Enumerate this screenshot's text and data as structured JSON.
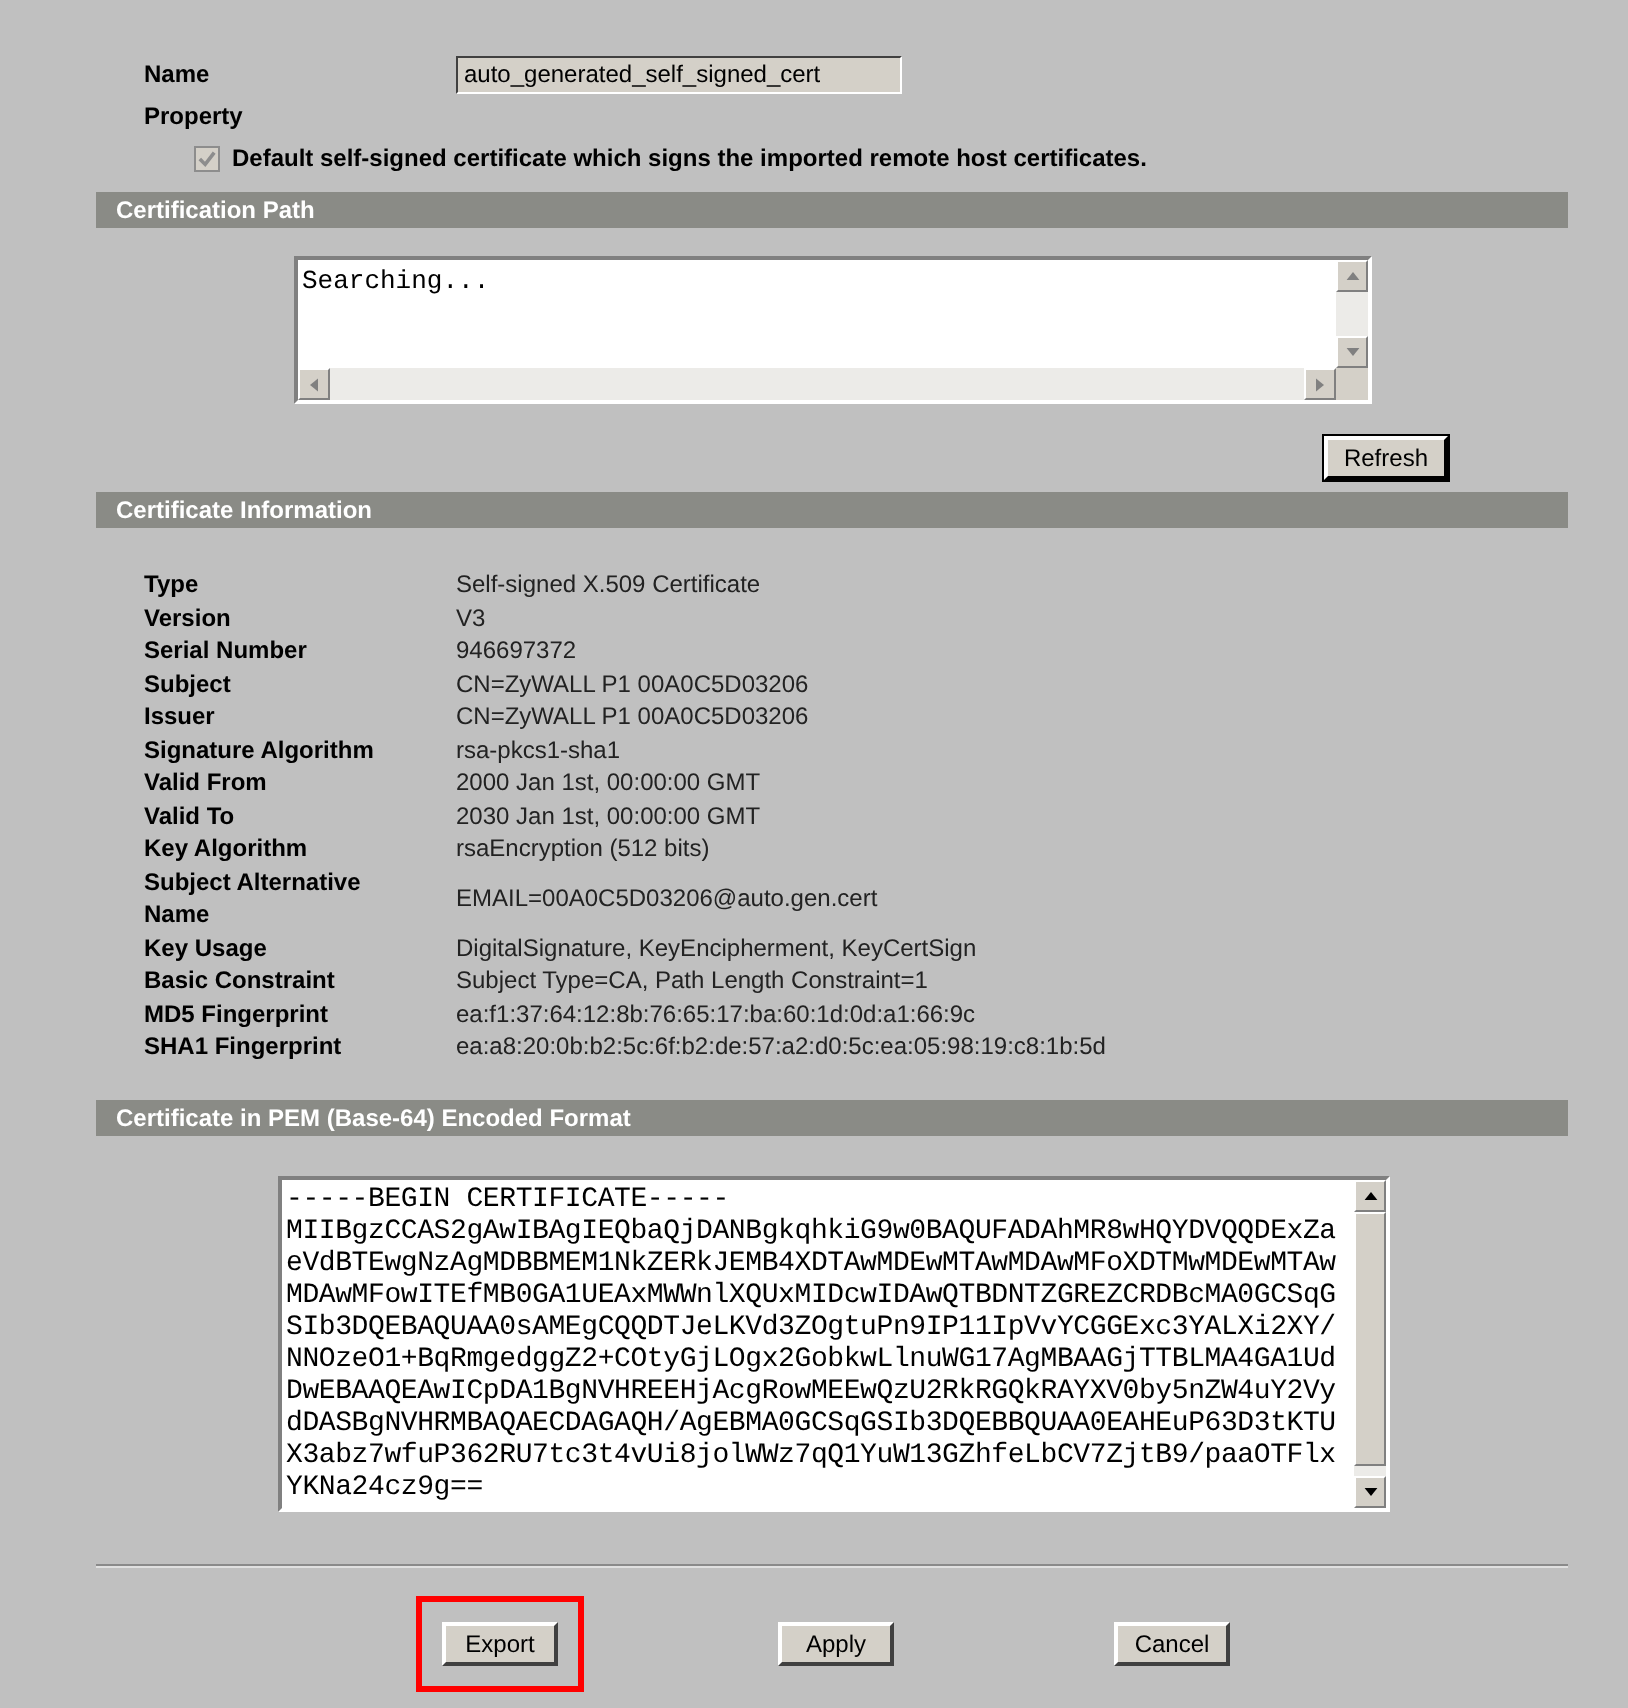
{
  "name": {
    "label": "Name",
    "value": "auto_generated_self_signed_cert"
  },
  "property": {
    "label": "Property",
    "checkbox": {
      "label": "Default self-signed certificate which signs the imported remote host certificates.",
      "checked": true,
      "disabled": true
    }
  },
  "certification_path": {
    "title": "Certification Path",
    "text": "Searching...",
    "refresh_button": "Refresh"
  },
  "certificate_information": {
    "title": "Certificate Information",
    "rows": [
      {
        "label": "Type",
        "value": "Self-signed X.509 Certificate"
      },
      {
        "label": "Version",
        "value": "V3"
      },
      {
        "label": "Serial Number",
        "value": "946697372"
      },
      {
        "label": "Subject",
        "value": "CN=ZyWALL P1 00A0C5D03206"
      },
      {
        "label": "Issuer",
        "value": "CN=ZyWALL P1 00A0C5D03206"
      },
      {
        "label": "Signature Algorithm",
        "value": "rsa-pkcs1-sha1"
      },
      {
        "label": "Valid From",
        "value": "2000 Jan 1st, 00:00:00 GMT"
      },
      {
        "label": "Valid To",
        "value": "2030 Jan 1st, 00:00:00 GMT"
      },
      {
        "label": "Key Algorithm",
        "value": "rsaEncryption (512 bits)"
      },
      {
        "label": "Subject Alternative Name",
        "value": "EMAIL=00A0C5D03206@auto.gen.cert"
      },
      {
        "label": "Key Usage",
        "value": "DigitalSignature, KeyEncipherment, KeyCertSign"
      },
      {
        "label": "Basic Constraint",
        "value": "Subject Type=CA, Path Length Constraint=1"
      },
      {
        "label": "MD5 Fingerprint",
        "value": "ea:f1:37:64:12:8b:76:65:17:ba:60:1d:0d:a1:66:9c"
      },
      {
        "label": "SHA1 Fingerprint",
        "value": "ea:a8:20:0b:b2:5c:6f:b2:de:57:a2:d0:5c:ea:05:98:19:c8:1b:5d"
      }
    ]
  },
  "pem": {
    "title": "Certificate in PEM (Base-64) Encoded Format",
    "lines": [
      "-----BEGIN CERTIFICATE-----",
      "MIIBgzCCAS2gAwIBAgIEQbaQjDANBgkqhkiG9w0BAQUFADAhMR8wHQYDVQQDExZa",
      "eVdBTEwgNzAgMDBBMEM1NkZERkJEMB4XDTAwMDEwMTAwMDAwMFoXDTMwMDEwMTAw",
      "MDAwMFowITEfMB0GA1UEAxMWWnlXQUxMIDcwIDAwQTBDNTZGREZCRDBcMA0GCSqG",
      "SIb3DQEBAQUAA0sAMEgCQQDTJeLKVd3ZOgtuPn9IP11IpVvYCGGExc3YALXi2XY/",
      "NNOzeO1+BqRmgedggZ2+COtyGjLOgx2GobkwLlnuWG17AgMBAAGjTTBLMA4GA1Ud",
      "DwEBAAQEAwICpDA1BgNVHREEHjAcgRowMEEwQzU2RkRGQkRAYXV0by5nZW4uY2Vy",
      "dDASBgNVHRMBAQAECDAGAQH/AgEBMA0GCSqGSIb3DQEBBQUAA0EAHEuP63D3tKTU",
      "X3abz7wfuP362RU7tc3t4vUi8jolWWz7qQ1YuW13GZhfeLbCV7ZjtB9/paaOTFlx",
      "YKNa24cz9g=="
    ]
  },
  "buttons": [
    {
      "label": "Export",
      "highlighted": true
    },
    {
      "label": "Apply",
      "highlighted": false
    },
    {
      "label": "Cancel",
      "highlighted": false
    }
  ]
}
